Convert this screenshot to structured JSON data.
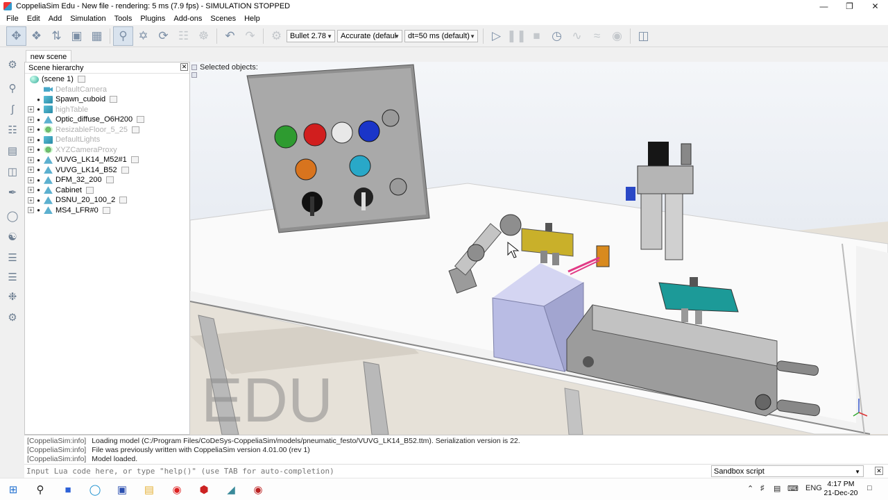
{
  "window": {
    "title": "CoppeliaSim Edu - New file - rendering: 5 ms (7.9 fps) - SIMULATION STOPPED",
    "minimize": "—",
    "maximize": "❐",
    "close": "✕"
  },
  "menu": [
    "File",
    "Edit",
    "Add",
    "Simulation",
    "Tools",
    "Plugins",
    "Add-ons",
    "Scenes",
    "Help"
  ],
  "toolbar": {
    "engine": "Bullet 2.78",
    "accuracy": "Accurate (defaul",
    "timestep": "dt=50 ms (default)"
  },
  "scene_tab": "new scene",
  "hierarchy": {
    "title": "Scene hierarchy",
    "close": "✕",
    "items": [
      {
        "label": "(scene 1)",
        "faded": false,
        "icon": "scene-icon"
      },
      {
        "label": "DefaultCamera",
        "faded": true,
        "icon": "camera-icon"
      },
      {
        "label": "Spawn_cuboid",
        "faded": false,
        "icon": "shape-icon"
      },
      {
        "label": "highTable",
        "faded": true,
        "icon": "shape-icon"
      },
      {
        "label": "Optic_diffuse_O6H200",
        "faded": false,
        "icon": "model-icon"
      },
      {
        "label": "ResizableFloor_5_25",
        "faded": true,
        "icon": "dummy-icon"
      },
      {
        "label": "DefaultLights",
        "faded": true,
        "icon": "light-icon"
      },
      {
        "label": "XYZCameraProxy",
        "faded": true,
        "icon": "dummy-icon"
      },
      {
        "label": "VUVG_LK14_M52#1",
        "faded": false,
        "icon": "model-icon"
      },
      {
        "label": "VUVG_LK14_B52",
        "faded": false,
        "icon": "model-icon"
      },
      {
        "label": "DFM_32_200",
        "faded": false,
        "icon": "model-icon"
      },
      {
        "label": "Cabinet",
        "faded": false,
        "icon": "model-icon"
      },
      {
        "label": "DSNU_20_100_2",
        "faded": false,
        "icon": "model-icon"
      },
      {
        "label": "MS4_LFR#0",
        "faded": false,
        "icon": "model-icon"
      }
    ]
  },
  "viewport": {
    "selected_label": "Selected objects:",
    "watermark": "EDU"
  },
  "console": {
    "lines": [
      {
        "tag": "[CoppeliaSim:info]",
        "text": "Loading model (C:/Program Files/CoDeSys-CoppeliaSim/models/pneumatic_festo/VUVG_LK14_B52.ttm).  Serialization version is 22."
      },
      {
        "tag": "[CoppeliaSim:info]",
        "text": "File was previously written with CoppeliaSim version 4.01.00 (rev 1)"
      },
      {
        "tag": "[CoppeliaSim:info]",
        "text": "Model loaded."
      }
    ],
    "input_placeholder": "Input Lua code here, or type \"help()\" (use TAB for auto-completion)",
    "script_select": "Sandbox script",
    "close": "✕"
  },
  "taskbar": {
    "lang": "ENG",
    "time": "4:17 PM",
    "date": "21-Dec-20"
  },
  "colors": {
    "accent": "#7c8fa6",
    "viewport_bg": "#eef1f5",
    "button_green": "#2e9b30",
    "button_red": "#d11e1e",
    "button_blue": "#1a35c8",
    "button_orange": "#d8741e",
    "button_cyan": "#29a8c8",
    "valve_yellow": "#c9b02a",
    "valve_teal": "#1c9a98",
    "cube_lavender": "#b9bce4"
  }
}
